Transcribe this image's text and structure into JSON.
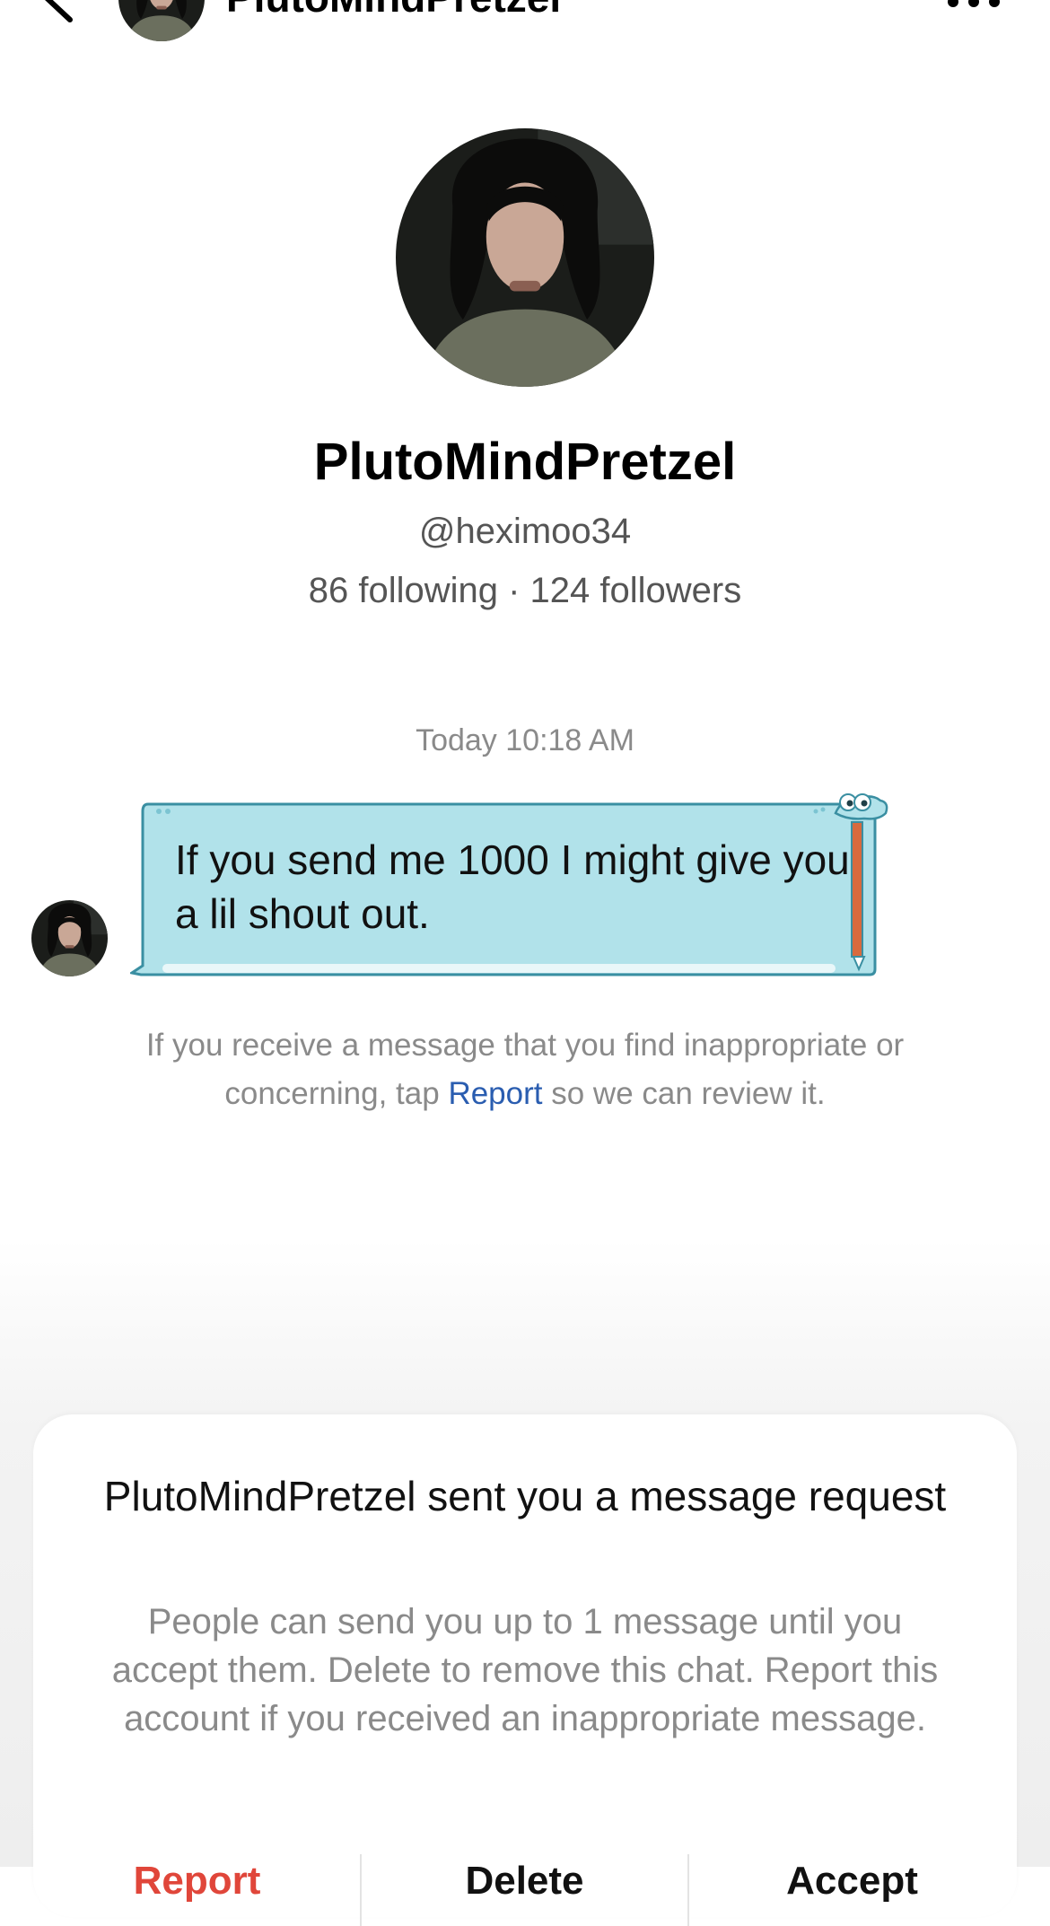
{
  "header": {
    "name": "PlutoMindPretzel"
  },
  "profile": {
    "name": "PlutoMindPretzel",
    "handle": "@heximoo34",
    "stats": "86 following · 124 followers"
  },
  "conversation": {
    "timestamp": "Today 10:18 AM",
    "message": "If you send me 1000 I might give you a lil shout out.",
    "notice_before": "If you receive a message that you find inappropriate or concerning, tap ",
    "notice_link": "Report",
    "notice_after": " so we can review it."
  },
  "request_sheet": {
    "title": "PlutoMindPretzel sent you a message request",
    "body": "People can send you up to 1 message until you accept them. Delete to remove this chat. Report this account if you received an inappropriate message.",
    "actions": {
      "report": "Report",
      "delete": "Delete",
      "accept": "Accept"
    }
  },
  "colors": {
    "bubble_fill": "#b1e2ea",
    "bubble_stroke": "#3a8fa2",
    "report_red": "#e0463a",
    "link_blue": "#2a5db0"
  }
}
